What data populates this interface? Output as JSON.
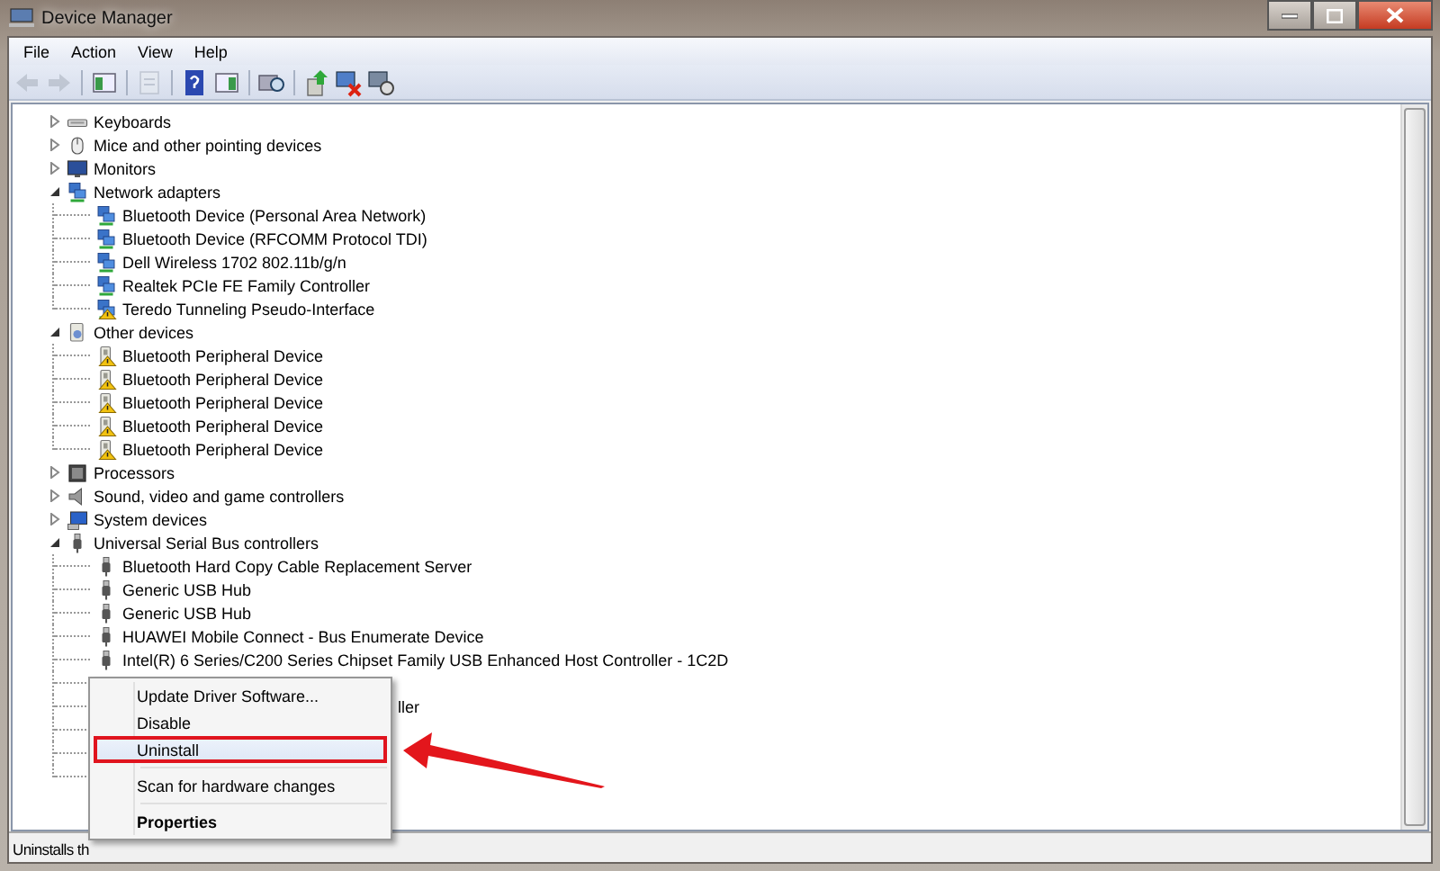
{
  "window": {
    "title": "Device Manager"
  },
  "menu_bar": [
    "File",
    "Action",
    "View",
    "Help"
  ],
  "toolbar": [
    {
      "kind": "back",
      "disabled": true
    },
    {
      "kind": "forward",
      "disabled": true
    },
    {
      "kind": "separator"
    },
    {
      "kind": "console",
      "disabled": false
    },
    {
      "kind": "separator"
    },
    {
      "kind": "properties",
      "disabled": true
    },
    {
      "kind": "separator"
    },
    {
      "kind": "help",
      "disabled": false
    },
    {
      "kind": "pane",
      "disabled": false
    },
    {
      "kind": "separator"
    },
    {
      "kind": "scan",
      "disabled": false
    },
    {
      "kind": "separator"
    },
    {
      "kind": "update",
      "disabled": false
    },
    {
      "kind": "uninstall",
      "disabled": false
    },
    {
      "kind": "disable",
      "disabled": false
    }
  ],
  "tree": [
    {
      "label": "Keyboards",
      "kind": "keyboard",
      "expanded": false,
      "warning": false
    },
    {
      "label": "Mice and other pointing devices",
      "kind": "mouse",
      "expanded": false,
      "warning": false
    },
    {
      "label": "Monitors",
      "kind": "monitor",
      "expanded": false,
      "warning": false
    },
    {
      "label": "Network adapters",
      "kind": "network",
      "expanded": true,
      "warning": false,
      "children": [
        {
          "label": "Bluetooth Device (Personal Area Network)",
          "kind": "network",
          "warning": false
        },
        {
          "label": "Bluetooth Device (RFCOMM Protocol TDI)",
          "kind": "network",
          "warning": false
        },
        {
          "label": "Dell Wireless 1702 802.11b/g/n",
          "kind": "network",
          "warning": false
        },
        {
          "label": "Realtek PCIe FE Family Controller",
          "kind": "network",
          "warning": false
        },
        {
          "label": "Teredo Tunneling Pseudo-Interface",
          "kind": "network",
          "warning": true
        }
      ]
    },
    {
      "label": "Other devices",
      "kind": "other",
      "expanded": true,
      "warning": false,
      "children": [
        {
          "label": "Bluetooth Peripheral Device",
          "kind": "device",
          "warning": true
        },
        {
          "label": "Bluetooth Peripheral Device",
          "kind": "device",
          "warning": true
        },
        {
          "label": "Bluetooth Peripheral Device",
          "kind": "device",
          "warning": true
        },
        {
          "label": "Bluetooth Peripheral Device",
          "kind": "device",
          "warning": true
        },
        {
          "label": "Bluetooth Peripheral Device",
          "kind": "device",
          "warning": true
        }
      ]
    },
    {
      "label": "Processors",
      "kind": "processor",
      "expanded": false,
      "warning": false
    },
    {
      "label": "Sound, video and game controllers",
      "kind": "sound",
      "expanded": false,
      "warning": false
    },
    {
      "label": "System devices",
      "kind": "system",
      "expanded": false,
      "warning": false
    },
    {
      "label": "Universal Serial Bus controllers",
      "kind": "usb",
      "expanded": true,
      "warning": false,
      "children": [
        {
          "label": "Bluetooth Hard Copy Cable Replacement Server",
          "kind": "usb",
          "warning": false
        },
        {
          "label": "Generic USB Hub",
          "kind": "usb",
          "warning": false
        },
        {
          "label": "Generic USB Hub",
          "kind": "usb",
          "warning": false
        },
        {
          "label": "HUAWEI Mobile Connect - Bus Enumerate Device",
          "kind": "usb",
          "warning": false
        },
        {
          "label": "Intel(R) 6 Series/C200 Series Chipset Family USB Enhanced Host Controller - 1C2D",
          "kind": "usb",
          "warning": false
        },
        {
          "kind": "covered"
        },
        {
          "label": "ller",
          "kind": "covered"
        },
        {
          "kind": "covered"
        },
        {
          "kind": "covered"
        },
        {
          "kind": "covered"
        }
      ]
    }
  ],
  "context_menu": [
    [
      {
        "label": "Update Driver Software...",
        "selected": false,
        "default": false
      },
      {
        "label": "Disable",
        "selected": false,
        "default": false
      },
      {
        "label": "Uninstall",
        "selected": true,
        "default": false
      }
    ],
    [
      {
        "label": "Scan for hardware changes",
        "selected": false,
        "default": false
      }
    ],
    [
      {
        "label": "Properties",
        "selected": false,
        "default": true
      }
    ]
  ],
  "status_bar": "Uninstalls th"
}
